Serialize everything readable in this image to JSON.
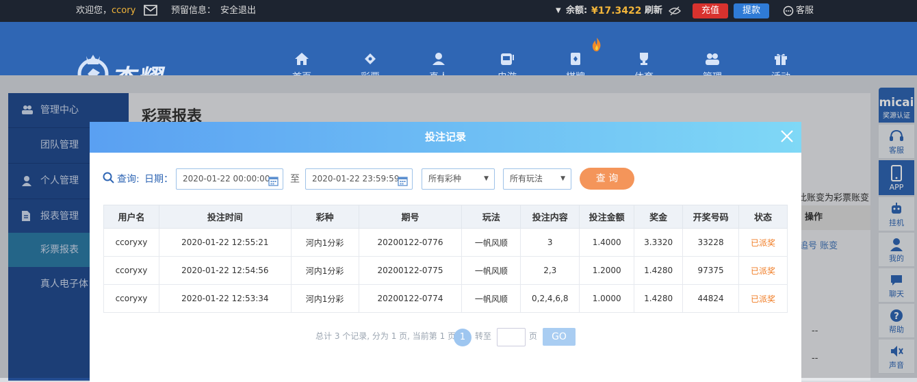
{
  "topbar": {
    "welcome": "欢迎您，",
    "username": "ccory",
    "notice_label": "预留信息：",
    "logout": "安全退出",
    "balance_label": "余额:",
    "balance_value": "¥17.3422",
    "refresh": "刷新",
    "recharge": "充值",
    "withdraw": "提款",
    "service": "客服"
  },
  "header": {
    "logo_text": "杏耀",
    "nav": [
      {
        "label": "首页",
        "icon": "home-icon"
      },
      {
        "label": "彩票",
        "icon": "lottery-icon"
      },
      {
        "label": "真人",
        "icon": "live-dealer-icon"
      },
      {
        "label": "电游",
        "icon": "slot-machine-icon"
      },
      {
        "label": "棋牌",
        "icon": "cards-icon"
      },
      {
        "label": "体育",
        "icon": "trophy-icon"
      },
      {
        "label": "管理",
        "icon": "users-icon"
      },
      {
        "label": "活动",
        "icon": "gift-icon"
      }
    ]
  },
  "sidebar": {
    "items": [
      {
        "label": "管理中心",
        "icon": "users-icon"
      },
      {
        "label": "团队管理"
      },
      {
        "label": "个人管理",
        "icon": "user-icon"
      },
      {
        "label": "报表管理",
        "icon": "document-icon"
      },
      {
        "label": "彩票报表"
      },
      {
        "label": "真人电子体"
      }
    ]
  },
  "content": {
    "title": "彩票报表",
    "note": "此账变为彩票账变",
    "op_header": "操作",
    "op_links": "追号 账变",
    "dash": "--"
  },
  "rightbar": {
    "items": [
      {
        "label": "奖源认证",
        "icon": "micai-icon",
        "top": "micai"
      },
      {
        "label": "客服",
        "icon": "headset-icon"
      },
      {
        "label": "APP",
        "icon": "phone-icon"
      },
      {
        "label": "挂机",
        "icon": "robot-icon"
      },
      {
        "label": "我的",
        "icon": "person-icon"
      },
      {
        "label": "聊天",
        "icon": "chat-icon"
      },
      {
        "label": "帮助",
        "icon": "help-icon"
      },
      {
        "label": "声音",
        "icon": "sound-icon"
      }
    ]
  },
  "modal": {
    "title": "投注记录",
    "query_label": "查询:",
    "date_label": "日期：",
    "date_from": "2020-01-22 00:00:00",
    "to_label": "至",
    "date_to": "2020-01-22 23:59:59",
    "lottery_select": "所有彩种",
    "play_select": "所有玩法",
    "query_button": "查 询",
    "columns": [
      "用户名",
      "投注时间",
      "彩种",
      "期号",
      "玩法",
      "投注内容",
      "投注金额",
      "奖金",
      "开奖号码",
      "状态"
    ],
    "rows": [
      [
        "ccoryxy",
        "2020-01-22 12:55:21",
        "河内1分彩",
        "20200122-0776",
        "一帆风顺",
        "3",
        "1.4000",
        "3.3320",
        "33228",
        "已派奖"
      ],
      [
        "ccoryxy",
        "2020-01-22 12:54:56",
        "河内1分彩",
        "20200122-0775",
        "一帆风顺",
        "2,3",
        "1.2000",
        "1.4280",
        "97375",
        "已派奖"
      ],
      [
        "ccoryxy",
        "2020-01-22 12:53:34",
        "河内1分彩",
        "20200122-0774",
        "一帆风顺",
        "0,2,4,6,8",
        "1.0000",
        "1.4280",
        "44824",
        "已派奖"
      ]
    ],
    "pager": {
      "summary": "总计 3 个记录, 分为 1 页, 当前第 1 页",
      "current": "1",
      "goto_label": "转至",
      "page_unit": "页",
      "go": "GO"
    }
  },
  "colors": {
    "header_blue": "#2f66b4",
    "accent_orange": "#f4955a",
    "status_orange": "#f07a20",
    "balance_gold": "#f2b53a"
  }
}
